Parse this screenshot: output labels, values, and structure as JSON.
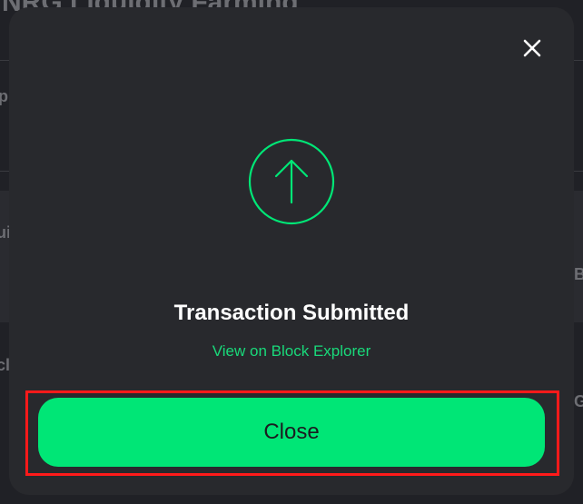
{
  "background": {
    "title": "NRG Liquidity Farming",
    "fragments": [
      "p",
      "ui",
      "cl",
      "B",
      "G"
    ]
  },
  "modal": {
    "status_icon": "arrow-up-circle-icon",
    "title": "Transaction Submitted",
    "explorer_link": "View on Block Explorer",
    "close_button": "Close",
    "close_icon": "close-icon"
  },
  "colors": {
    "accent": "#00e676",
    "link": "#19d97a",
    "modal_bg": "#28292d",
    "highlight": "#ff1a1a"
  }
}
